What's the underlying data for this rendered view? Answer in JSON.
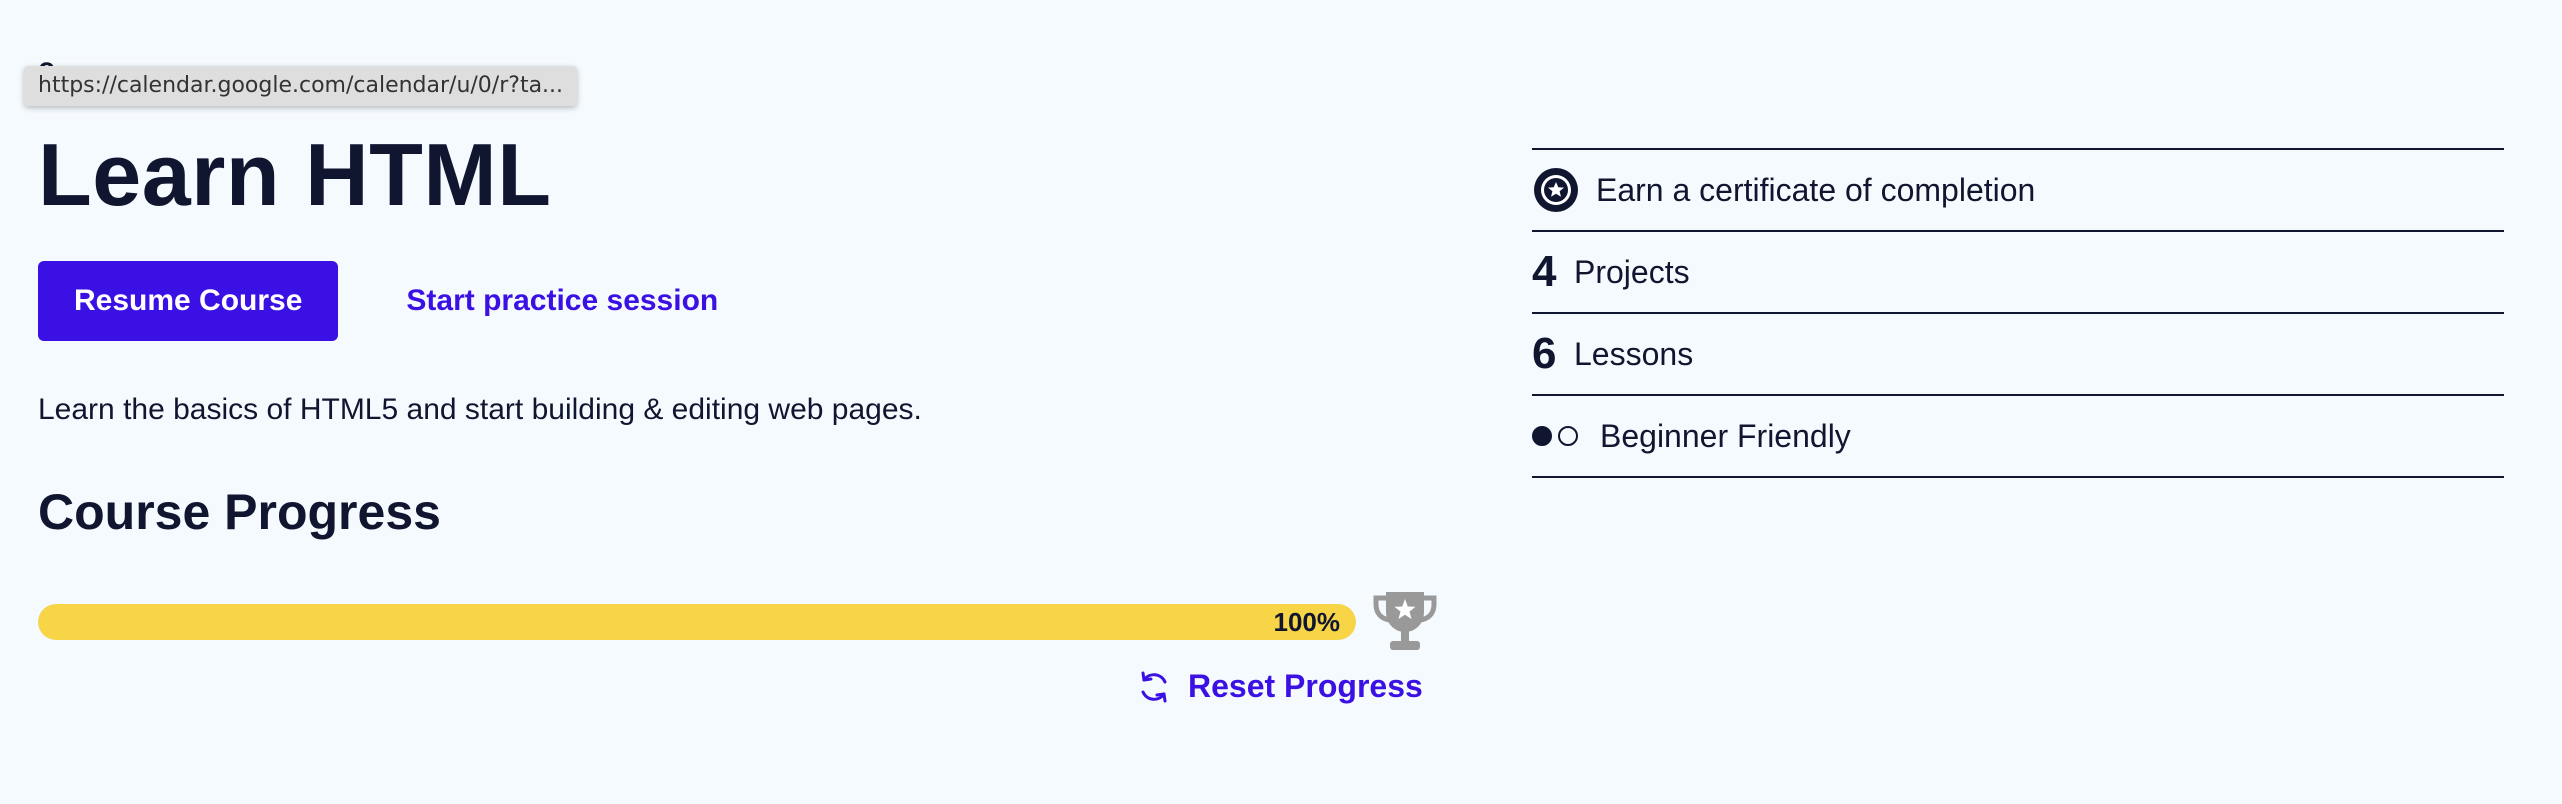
{
  "tooltip": {
    "url": "https://calendar.google.com/calendar/u/0/r?ta..."
  },
  "course": {
    "title": "Learn HTML",
    "description": "Learn the basics of HTML5 and start building & editing web pages."
  },
  "actions": {
    "resume_label": "Resume Course",
    "practice_label": "Start practice session"
  },
  "progress": {
    "heading": "Course Progress",
    "percent": 100,
    "percent_label": "100%",
    "reset_label": "Reset Progress"
  },
  "features": {
    "certificate": "Earn a certificate of completion",
    "projects_count": "4",
    "projects_label": "Projects",
    "lessons_count": "6",
    "lessons_label": "Lessons",
    "level_label": "Beginner Friendly"
  },
  "icons": {
    "certificate": "certificate-star-icon",
    "trophy": "trophy-icon",
    "reset": "refresh-icon",
    "level": "difficulty-dots-icon"
  },
  "colors": {
    "primary": "#3a10e5",
    "progress_fill": "#f8d447",
    "text": "#10162f",
    "background": "#f5fafe",
    "trophy": "#999999"
  }
}
